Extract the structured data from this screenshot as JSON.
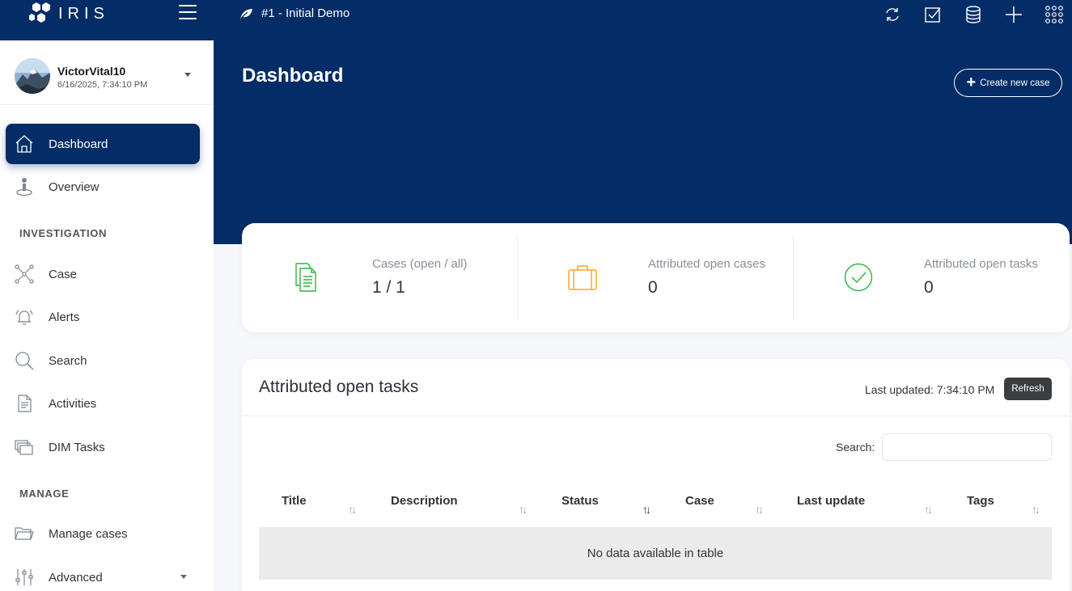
{
  "app": {
    "logo_text": "IRIS",
    "case_title": "#1 - Initial Demo"
  },
  "topbar": {
    "icons": [
      "refresh-icon",
      "tasks-check-icon",
      "database-icon",
      "plus-icon",
      "apps-grid-icon"
    ]
  },
  "user": {
    "name": "VictorVital10",
    "datetime": "6/16/2025, 7:34:10 PM"
  },
  "sidebar": {
    "items": [
      {
        "label": "Dashboard",
        "icon": "home-icon",
        "active": true
      },
      {
        "label": "Overview",
        "icon": "overview-pin-icon"
      }
    ],
    "sections": {
      "investigation": {
        "title": "INVESTIGATION",
        "items": [
          {
            "label": "Case",
            "icon": "case-network-icon"
          },
          {
            "label": "Alerts",
            "icon": "alerts-bell-icon"
          },
          {
            "label": "Search",
            "icon": "search-icon"
          },
          {
            "label": "Activities",
            "icon": "activities-doc-icon"
          },
          {
            "label": "DIM Tasks",
            "icon": "dim-tasks-icon"
          }
        ]
      },
      "manage": {
        "title": "MANAGE",
        "items": [
          {
            "label": "Manage cases",
            "icon": "folder-icon"
          },
          {
            "label": "Advanced",
            "icon": "sliders-icon"
          }
        ]
      }
    }
  },
  "main": {
    "page_title": "Dashboard",
    "create_button": "Create new case",
    "stats": [
      {
        "title": "Cases (open / all)",
        "value": "1 / 1",
        "icon": "cases-doc-icon",
        "color": "#2fb344"
      },
      {
        "title": "Attributed open cases",
        "value": "0",
        "icon": "briefcase-icon",
        "color": "#f5a623"
      },
      {
        "title": "Attributed open tasks",
        "value": "0",
        "icon": "check-circle-icon",
        "color": "#2fb344"
      }
    ],
    "tasks": {
      "title": "Attributed open tasks",
      "last_updated": "Last updated: 7:34:10 PM",
      "refresh_label": "Refresh",
      "search_label": "Search:",
      "search_value": "",
      "columns": [
        "Title",
        "Description",
        "Status",
        "Case",
        "Last update",
        "Tags"
      ],
      "sorted_column": "Status",
      "empty_text": "No data available in table"
    }
  },
  "colors": {
    "primary": "#042c66",
    "success": "#2fb344",
    "warning": "#f5a623"
  }
}
